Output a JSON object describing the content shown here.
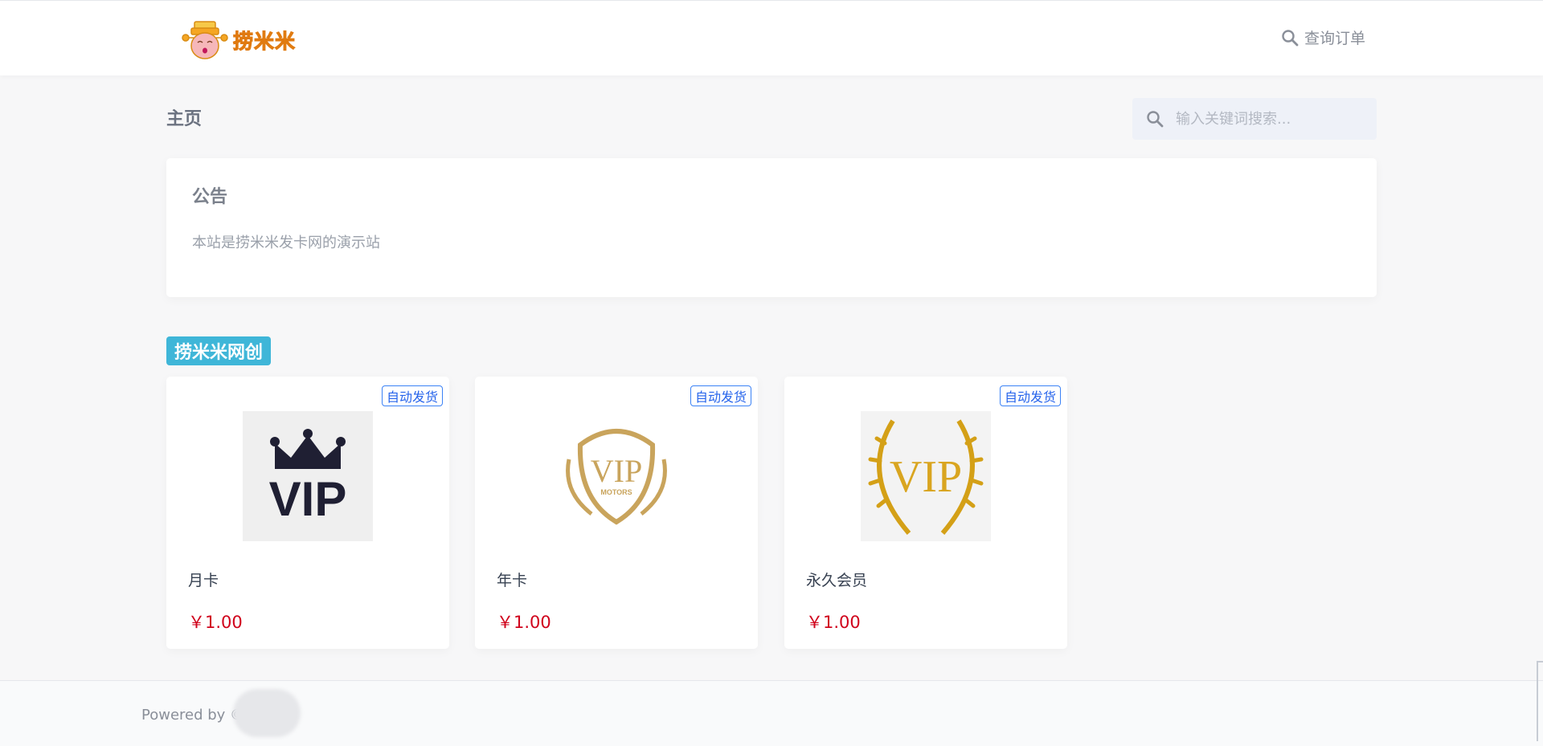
{
  "header": {
    "logo_text": "捞米米",
    "query_order_label": "查询订单",
    "query_order_icon": "search-icon"
  },
  "page": {
    "title": "主页"
  },
  "search": {
    "placeholder": "输入关键词搜索...",
    "icon": "search-icon"
  },
  "notice": {
    "title": "公告",
    "text": "本站是捞米米发卡网的演示站"
  },
  "category": {
    "name": "捞米米网创"
  },
  "products": [
    {
      "badge": "自动发货",
      "name": "月卡",
      "price": "￥1.00",
      "image": "vip-crown-icon"
    },
    {
      "badge": "自动发货",
      "name": "年卡",
      "price": "￥1.00",
      "image": "vip-shield-icon"
    },
    {
      "badge": "自动发货",
      "name": "永久会员",
      "price": "￥1.00",
      "image": "vip-laurel-icon"
    }
  ],
  "footer": {
    "text": "Powered by ©         卡."
  },
  "colors": {
    "accent_blue": "#3fb6d8",
    "badge_blue": "#2563eb",
    "price_red": "#d0021b",
    "logo_orange": "#f5a623",
    "gold": "#c9a45c"
  }
}
